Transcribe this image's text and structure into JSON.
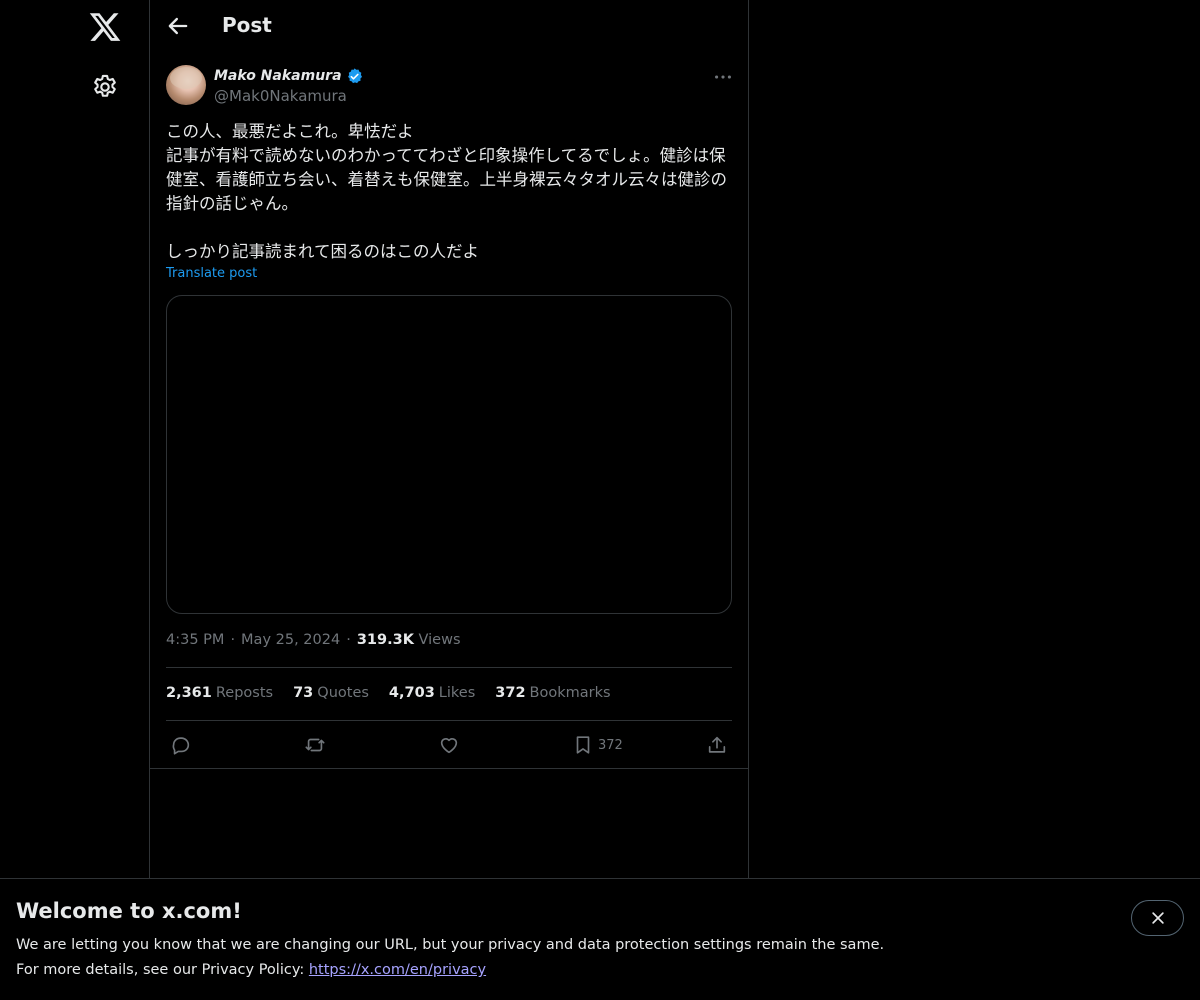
{
  "header": {
    "title": "Post"
  },
  "post": {
    "author_name": "Mako Nakamura",
    "author_handle": "@Mak0Nakamura",
    "text": "この人、最悪だよこれ。卑怯だよ\n記事が有料で読めないのわかっててわざと印象操作してるでしょ。健診は保健室、看護師立ち会い、着替えも保健室。上半身裸云々タオル云々は健診の指針の話じゃん。\n\nしっかり記事読まれて困るのはこの人だよ",
    "translate_label": "Translate post",
    "time": "4:35 PM",
    "date": "May 25, 2024",
    "views_count": "319.3K",
    "views_label": "Views",
    "stats": [
      {
        "num": "2,361",
        "label": "Reposts"
      },
      {
        "num": "73",
        "label": "Quotes"
      },
      {
        "num": "4,703",
        "label": "Likes"
      },
      {
        "num": "372",
        "label": "Bookmarks"
      }
    ],
    "bookmark_count": "372"
  },
  "banner": {
    "title": "Welcome to x.com!",
    "line1": "We are letting you know that we are changing our URL, but your privacy and data protection settings remain the same.",
    "line2_prefix": "For more details, see our Privacy Policy: ",
    "link": "https://x.com/en/privacy"
  },
  "icons": {
    "logo": "x-logo-icon",
    "settings": "gear-icon",
    "back": "arrow-left-icon",
    "more": "more-horizontal-icon",
    "verified": "verified-badge-icon",
    "reply": "reply-icon",
    "repost": "repost-icon",
    "like": "heart-icon",
    "bookmark": "bookmark-icon",
    "share": "share-icon",
    "close": "close-icon"
  },
  "colors": {
    "accent": "#1d9bf0",
    "link": "#a6a3ff",
    "muted": "#71767b",
    "border": "#2f3336"
  }
}
